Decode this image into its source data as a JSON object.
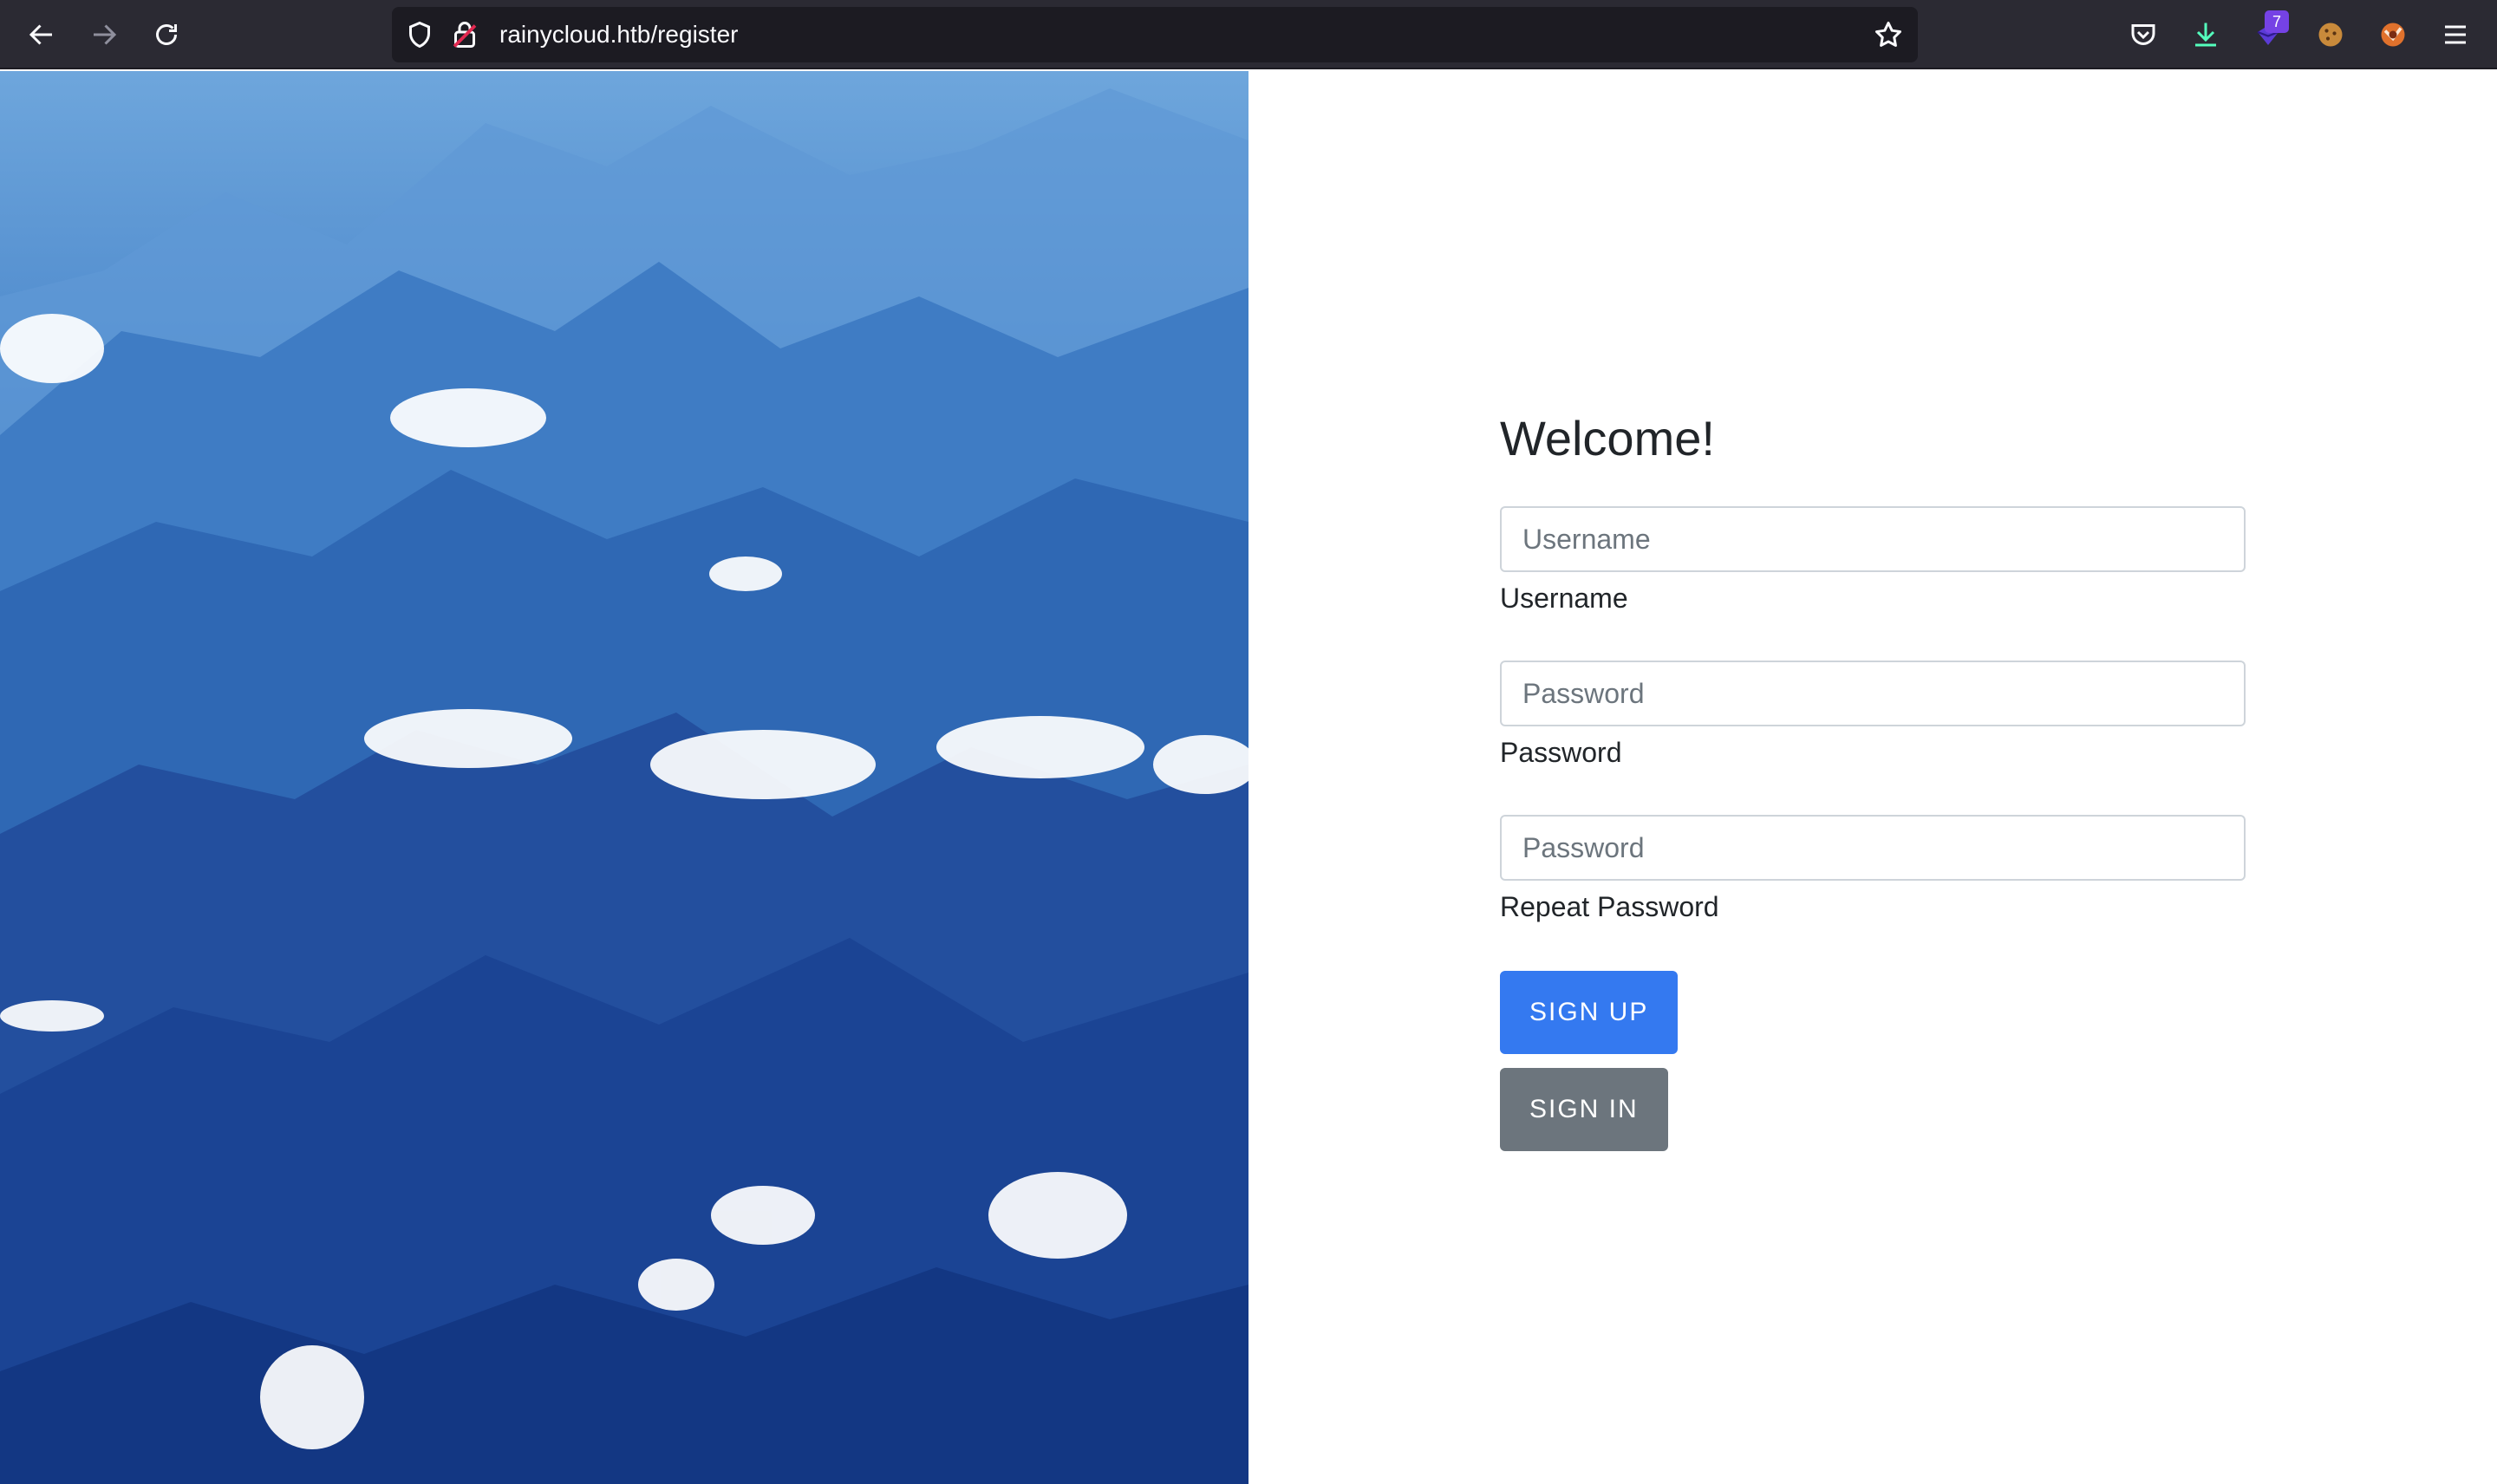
{
  "browser": {
    "url": "rainycloud.htb/register",
    "extension_badge_count": "7",
    "icons": [
      "back-arrow-icon",
      "forward-arrow-icon",
      "reload-icon",
      "shield-icon",
      "insecure-lock-icon",
      "bookmark-star-icon",
      "pocket-icon",
      "download-icon",
      "extension-icon",
      "cookie-icon",
      "fox-extension-icon",
      "hamburger-menu-icon"
    ]
  },
  "form": {
    "title": "Welcome!",
    "username": {
      "placeholder": "Username",
      "label": "Username"
    },
    "password": {
      "placeholder": "Password",
      "label": "Password"
    },
    "repeat_password": {
      "placeholder": "Password",
      "label": "Repeat Password"
    },
    "signup_label": "SIGN UP",
    "signin_label": "SIGN IN"
  },
  "colors": {
    "toolbar": "#2b2a33",
    "primary_button": "#3479f0",
    "secondary_button": "#6c757d",
    "sky_blue": "#4d89cc",
    "deep_blue": "#163d8a"
  }
}
